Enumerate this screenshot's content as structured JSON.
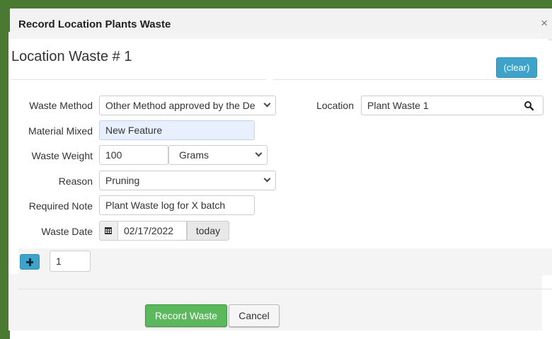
{
  "dialog": {
    "title": "Record Location Plants Waste",
    "close_label": "×"
  },
  "section": {
    "title": "Location Waste # 1",
    "clear_label": "(clear)"
  },
  "form": {
    "waste_method": {
      "label": "Waste Method",
      "value": "Other Method approved by the De"
    },
    "material_mixed": {
      "label": "Material Mixed",
      "value": "New Feature"
    },
    "waste_weight": {
      "label": "Waste Weight",
      "value": "100",
      "unit": "Grams"
    },
    "reason": {
      "label": "Reason",
      "value": "Pruning"
    },
    "required_note": {
      "label": "Required Note",
      "value": "Plant Waste log for X batch"
    },
    "waste_date": {
      "label": "Waste Date",
      "value": "02/17/2022",
      "today_label": "today"
    },
    "location": {
      "label": "Location",
      "value": "Plant Waste 1"
    }
  },
  "add_row": {
    "count": "1"
  },
  "actions": {
    "record_label": "Record Waste",
    "cancel_label": "Cancel"
  },
  "colors": {
    "primary": "#3fa3c9",
    "success": "#5cb85c",
    "page_background": "#4a7a32"
  },
  "icons": {
    "search": "search-icon",
    "calendar": "calendar-icon",
    "plus": "plus-icon"
  }
}
